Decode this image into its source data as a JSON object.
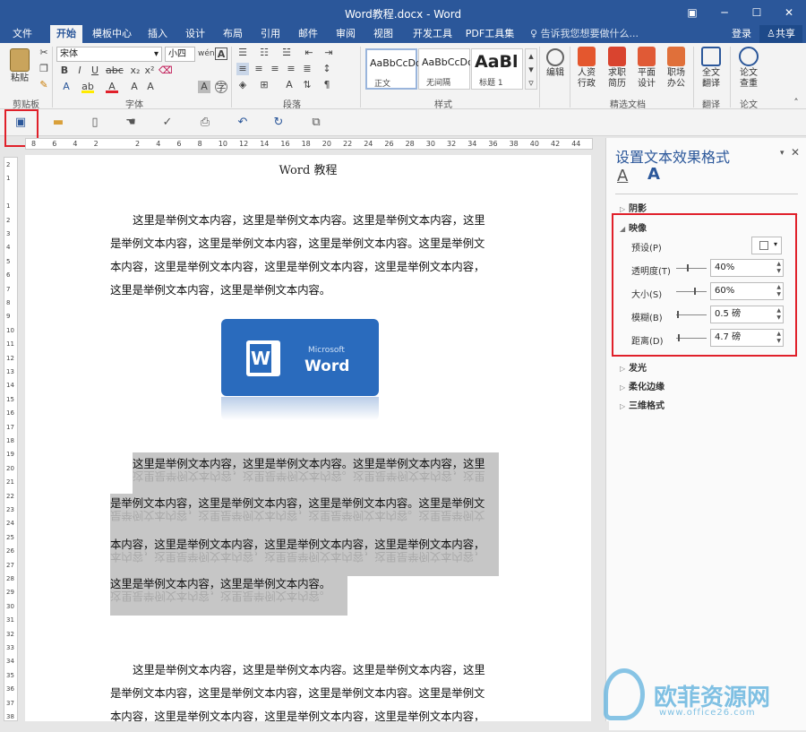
{
  "window": {
    "title": "Word教程.docx - Word"
  },
  "tabs": [
    "文件",
    "开始",
    "模板中心",
    "插入",
    "设计",
    "布局",
    "引用",
    "邮件",
    "审阅",
    "视图",
    "开发工具",
    "PDF工具集"
  ],
  "tell_me": "告诉我您想要做什么...",
  "account": {
    "login": "登录",
    "share": "共享"
  },
  "ribbon": {
    "paste": "粘贴",
    "font_name": "宋体",
    "font_size": "小四",
    "styles": [
      {
        "preview": "AaBbCcDd",
        "name": "正文"
      },
      {
        "preview": "AaBbCcDd",
        "name": "无间隔"
      },
      {
        "preview": "AaBl",
        "name": "标题 1"
      }
    ],
    "edit": "编辑",
    "templates": [
      "人资\n行政",
      "求职\n简历",
      "平面\n设计",
      "职场\n办公"
    ],
    "translate": "全文\n翻译",
    "paper": "论文\n查重",
    "groups": [
      "剪贴板",
      "字体",
      "段落",
      "样式",
      "精选文档",
      "翻译",
      "论文"
    ]
  },
  "ruler": [
    "8",
    "6",
    "4",
    "2",
    "",
    "2",
    "4",
    "6",
    "8",
    "10",
    "12",
    "14",
    "16",
    "18",
    "20",
    "22",
    "24",
    "26",
    "28",
    "30",
    "32",
    "34",
    "36",
    "38",
    "40",
    "42",
    "44"
  ],
  "vruler": [
    "2",
    "1",
    "",
    "1",
    "2",
    "3",
    "4",
    "5",
    "6",
    "7",
    "8",
    "9",
    "10",
    "11",
    "12",
    "13",
    "14",
    "15",
    "16",
    "17",
    "18",
    "19",
    "20",
    "21",
    "22",
    "23",
    "24",
    "25",
    "26",
    "27",
    "28",
    "29",
    "30",
    "31",
    "32",
    "33",
    "34",
    "35",
    "36",
    "37",
    "38"
  ],
  "doc": {
    "heading": "Word 教程",
    "para1": [
      "这里是举例文本内容，这里是举例文本内容。这里是举例文本内容，这里",
      "是举例文本内容，这里是举例文本内容，这里是举例文本内容。这里是举例文",
      "本内容，这里是举例文本内容，这里是举例文本内容，这里是举例文本内容，",
      "这里是举例文本内容，这里是举例文本内容。"
    ],
    "logo_small": "Microsoft",
    "logo_big": "Word",
    "para2": [
      "这里是举例文本内容，这里是举例文本内容。这里是举例文本内容，这里",
      "是举例文本内容，这里是举例文本内容，这里是举例文本内容。这里是举例文",
      "本内容，这里是举例文本内容，这里是举例文本内容，这里是举例文本内容，",
      "这里是举例文本内容，这里是举例文本内容。"
    ],
    "para3": [
      "这里是举例文本内容，这里是举例文本内容。这里是举例文本内容，这里",
      "是举例文本内容，这里是举例文本内容，这里是举例文本内容。这里是举例文",
      "本内容，这里是举例文本内容，这里是举例文本内容，这里是举例文本内容，"
    ]
  },
  "panel": {
    "title": "设置文本效果格式",
    "sections": {
      "shadow": "阴影",
      "reflection": "映像",
      "glow": "发光",
      "soft_edges": "柔化边缘",
      "format_3d": "三维格式"
    },
    "fields": [
      {
        "label": "预设(P)"
      },
      {
        "label": "透明度(T)",
        "value": "40%"
      },
      {
        "label": "大小(S)",
        "value": "60%"
      },
      {
        "label": "模糊(B)",
        "value": "0.5 磅"
      },
      {
        "label": "距离(D)",
        "value": "4.7 磅"
      }
    ]
  },
  "watermark": {
    "text": "欧菲资源网",
    "url": "www.office26.com"
  },
  "colors": {
    "accent": "#2b579a",
    "highlight": "#e0202a"
  }
}
